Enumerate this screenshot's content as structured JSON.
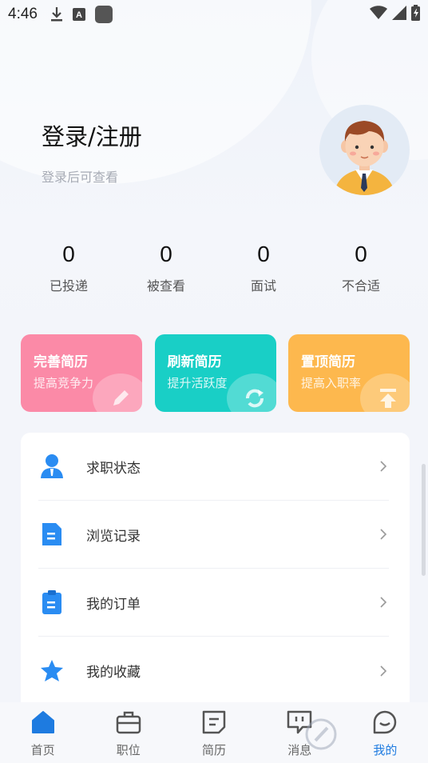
{
  "status_bar": {
    "time": "4:46",
    "icons": [
      "download-icon",
      "a-keyboard-icon",
      "app-square-icon",
      "wifi-icon",
      "signal-icon",
      "battery-charging-icon"
    ]
  },
  "profile": {
    "title": "登录/注册",
    "subtitle": "登录后可查看",
    "avatar_icon": "avatar-man-icon"
  },
  "stats": [
    {
      "value": "0",
      "label": "已投递"
    },
    {
      "value": "0",
      "label": "被查看"
    },
    {
      "value": "0",
      "label": "面试"
    },
    {
      "value": "0",
      "label": "不合适"
    }
  ],
  "cards": [
    {
      "title": "完善简历",
      "subtitle": "提高竞争力",
      "color": "#fb8aa7",
      "icon": "pencil-icon"
    },
    {
      "title": "刷新简历",
      "subtitle": "提升活跃度",
      "color": "#19cfc6",
      "icon": "refresh-icon"
    },
    {
      "title": "置顶简历",
      "subtitle": "提高入职率",
      "color": "#fdb84e",
      "icon": "top-arrow-icon"
    }
  ],
  "menu": [
    {
      "label": "求职状态",
      "icon": "person-icon"
    },
    {
      "label": "浏览记录",
      "icon": "document-icon"
    },
    {
      "label": "我的订单",
      "icon": "clipboard-icon"
    },
    {
      "label": "我的收藏",
      "icon": "star-icon"
    }
  ],
  "bottom_nav": [
    {
      "label": "首页",
      "icon": "home-icon",
      "active": false
    },
    {
      "label": "职位",
      "icon": "briefcase-icon",
      "active": false
    },
    {
      "label": "简历",
      "icon": "resume-icon",
      "active": false
    },
    {
      "label": "消息",
      "icon": "message-icon",
      "active": false
    },
    {
      "label": "我的",
      "icon": "profile-icon",
      "active": true
    }
  ],
  "colors": {
    "accent": "#1e7be0",
    "menu_icon": "#2a8cf2"
  }
}
